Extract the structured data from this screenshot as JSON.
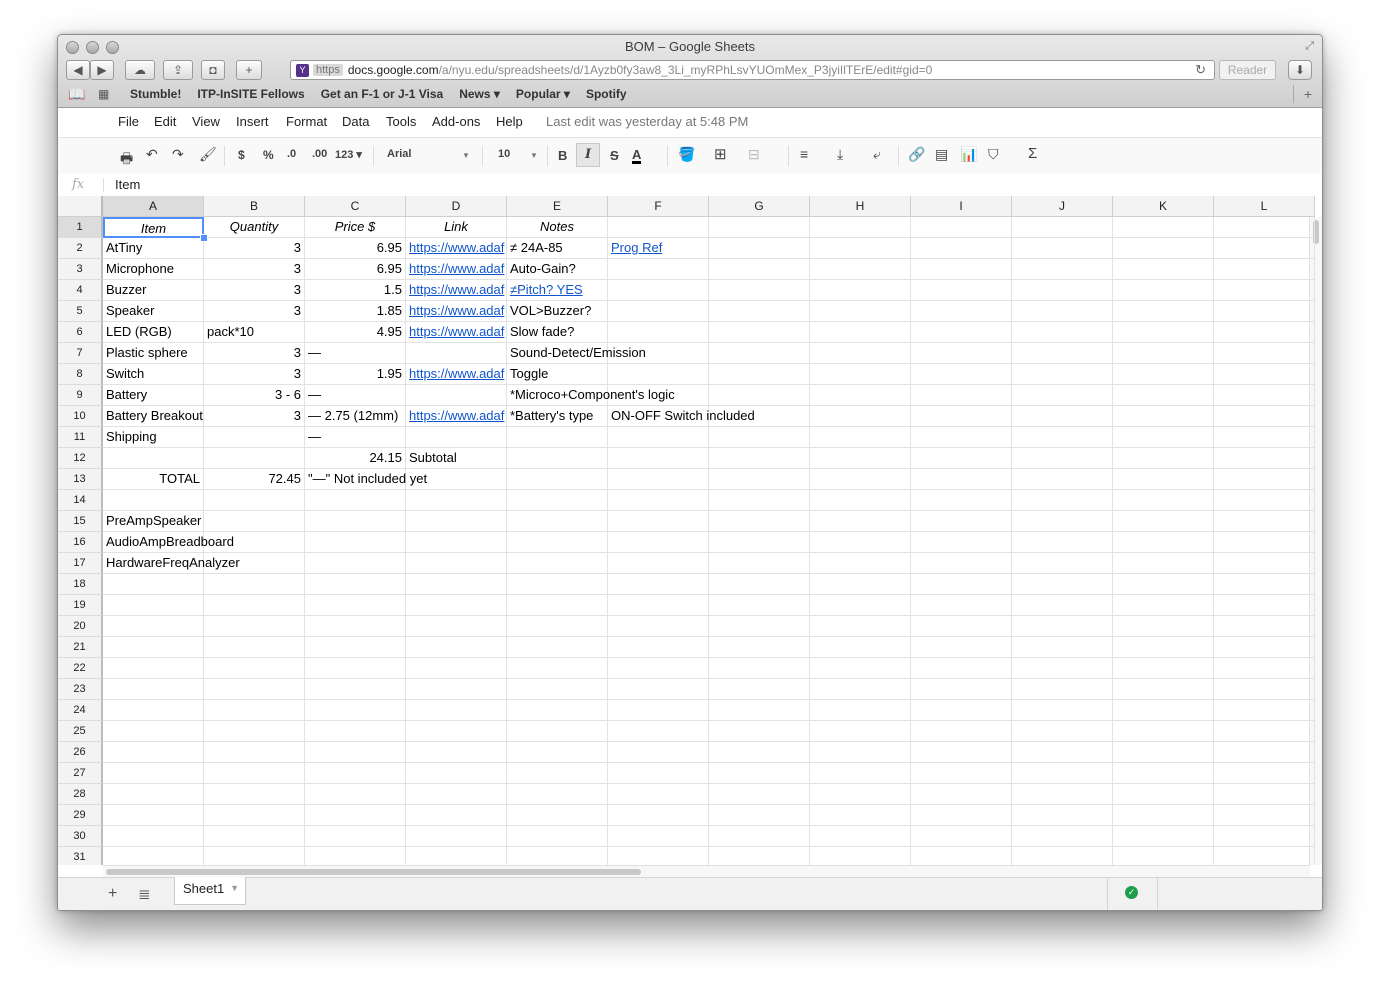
{
  "window": {
    "title": "BOM – Google Sheets"
  },
  "browser": {
    "url_scheme": "https",
    "url_domain": "docs.google.com",
    "url_path": "/a/nyu.edu/spreadsheets/d/1Ayzb0fy3aw8_3Li_myRPhLsvYUOmMex_P3jyiIlTErE/edit#gid=0",
    "reader_label": "Reader",
    "bookmarks": [
      "Stumble!",
      "ITP-InSITE Fellows",
      "Get an F-1 or J-1 Visa",
      "News ▾",
      "Popular ▾",
      "Spotify"
    ]
  },
  "menu": {
    "items": [
      "File",
      "Edit",
      "View",
      "Insert",
      "Format",
      "Data",
      "Tools",
      "Add-ons",
      "Help"
    ],
    "last_edit": "Last edit was yesterday at 5:48 PM"
  },
  "toolbar": {
    "currency": "$",
    "percent": "%",
    "decrease_decimal": ".0",
    "increase_decimal": ".00",
    "more_formats": "123 ▾",
    "font": "Arial",
    "font_size": "10",
    "bold": "B",
    "italic": "I",
    "strike": "S",
    "text_color": "A"
  },
  "formula_bar": {
    "fx_label": "fx",
    "value": "Item"
  },
  "columns": [
    "A",
    "B",
    "C",
    "D",
    "E",
    "F",
    "G",
    "H",
    "I",
    "J",
    "K",
    "L"
  ],
  "rows": [
    {
      "n": "1",
      "A": "Item",
      "B": "Quantity",
      "C": "Price $",
      "D": "Link",
      "E": "Notes",
      "F": ""
    },
    {
      "n": "2",
      "A": "AtTiny",
      "B": "3",
      "C": "6.95",
      "D": "https://www.adaf",
      "E": "≠ 24A-85",
      "F": "Prog Ref"
    },
    {
      "n": "3",
      "A": "Microphone",
      "B": "3",
      "C": "6.95",
      "D": "https://www.adaf",
      "E": "Auto-Gain?",
      "F": ""
    },
    {
      "n": "4",
      "A": "Buzzer",
      "B": "3",
      "C": "1.5",
      "D": "https://www.adaf",
      "E": "≠Pitch? YES",
      "F": ""
    },
    {
      "n": "5",
      "A": "Speaker",
      "B": "3",
      "C": "1.85",
      "D": "https://www.adaf",
      "E": "VOL>Buzzer?",
      "F": ""
    },
    {
      "n": "6",
      "A": "LED (RGB)",
      "B": "pack*10",
      "C": "4.95",
      "D": "https://www.adaf",
      "E": "Slow fade?",
      "F": ""
    },
    {
      "n": "7",
      "A": "Plastic sphere",
      "B": "3",
      "C": "—",
      "D": "",
      "E": "Sound-Detect/Emission",
      "F": ""
    },
    {
      "n": "8",
      "A": "Switch",
      "B": "3",
      "C": "1.95",
      "D": "https://www.adaf",
      "E": "Toggle",
      "F": ""
    },
    {
      "n": "9",
      "A": "Battery",
      "B": "3 - 6",
      "C": "—",
      "D": "",
      "E": "*Microco+Component's logic",
      "F": ""
    },
    {
      "n": "10",
      "A": "Battery Breakout",
      "B": "3",
      "C": "— 2.75 (12mm)",
      "D": "https://www.adaf",
      "E": "*Battery's type",
      "F": "ON-OFF Switch included"
    },
    {
      "n": "11",
      "A": "Shipping",
      "B": "",
      "C": "—",
      "D": "",
      "E": "",
      "F": ""
    },
    {
      "n": "12",
      "A": "",
      "B": "",
      "C": "24.15",
      "D": "Subtotal",
      "E": "",
      "F": ""
    },
    {
      "n": "13",
      "A": "TOTAL",
      "B": "72.45",
      "C": "\"—\" Not included yet",
      "D": "",
      "E": "",
      "F": ""
    },
    {
      "n": "14",
      "A": "",
      "B": "",
      "C": "",
      "D": "",
      "E": "",
      "F": ""
    },
    {
      "n": "15",
      "A": "PreAmpSpeaker",
      "B": "",
      "C": "",
      "D": "",
      "E": "",
      "F": ""
    },
    {
      "n": "16",
      "A": "AudioAmpBreadboard",
      "B": "",
      "C": "",
      "D": "",
      "E": "",
      "F": ""
    },
    {
      "n": "17",
      "A": "HardwareFreqAnalyzer",
      "B": "",
      "C": "",
      "D": "",
      "E": "",
      "F": ""
    },
    {
      "n": "18"
    },
    {
      "n": "19"
    },
    {
      "n": "20"
    },
    {
      "n": "21"
    },
    {
      "n": "22"
    },
    {
      "n": "23"
    },
    {
      "n": "24"
    },
    {
      "n": "25"
    },
    {
      "n": "26"
    },
    {
      "n": "27"
    },
    {
      "n": "28"
    },
    {
      "n": "29"
    },
    {
      "n": "30"
    },
    {
      "n": "31"
    }
  ],
  "sheet_tab": "Sheet1",
  "colors": {
    "link": "#1155cc",
    "selection": "#4d90fe",
    "saved": "#1e9e4b"
  }
}
